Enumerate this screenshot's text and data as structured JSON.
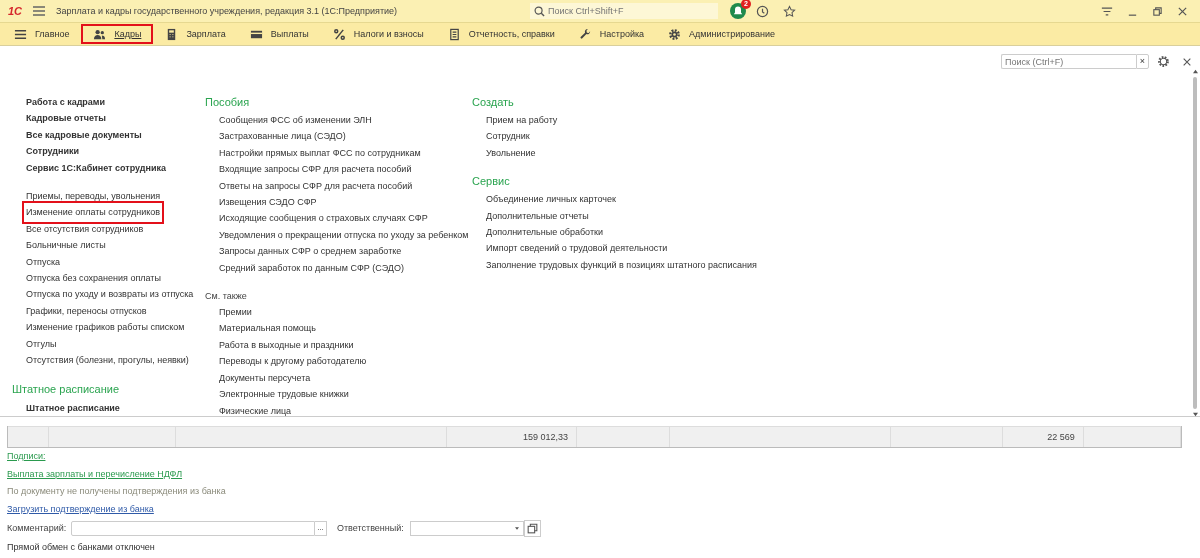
{
  "title_bar": {
    "logo": "1С",
    "title": "Зарплата и кадры государственного учреждения, редакция 3.1  (1С:Предприятие)",
    "search": {
      "placeholder": "Поиск Ctrl+Shift+F"
    },
    "notification_count": "2"
  },
  "sections": [
    {
      "label": "Главное",
      "selected": false,
      "highlighted": false
    },
    {
      "label": "Кадры",
      "selected": true,
      "highlighted": true
    },
    {
      "label": "Зарплата",
      "selected": false,
      "highlighted": false
    },
    {
      "label": "Выплаты",
      "selected": false,
      "highlighted": false
    },
    {
      "label": "Налоги и взносы",
      "selected": false,
      "highlighted": false
    },
    {
      "label": "Отчетность, справки",
      "selected": false,
      "highlighted": false
    },
    {
      "label": "Настройка",
      "selected": false,
      "highlighted": false
    },
    {
      "label": "Администрирование",
      "selected": false,
      "highlighted": false
    }
  ],
  "panel": {
    "search": {
      "placeholder": "Поиск (Ctrl+F)",
      "clear_button": "×"
    },
    "main_links": [
      "Работа с кадрами",
      "Кадровые отчеты",
      "Все кадровые документы",
      "Сотрудники",
      "Сервис 1С:Кабинет сотрудника"
    ],
    "links": [
      {
        "label": "Приемы, переводы, увольнения",
        "highlighted": false
      },
      {
        "label": "Изменение оплаты сотрудников",
        "highlighted": true
      },
      {
        "label": "Все отсутствия сотрудников",
        "highlighted": false
      },
      {
        "label": "Больничные листы",
        "highlighted": false
      },
      {
        "label": "Отпуска",
        "highlighted": false
      },
      {
        "label": "Отпуска без сохранения оплаты",
        "highlighted": false
      },
      {
        "label": "Отпуска по уходу и возвраты из отпуска",
        "highlighted": false
      },
      {
        "label": "Графики, переносы отпусков",
        "highlighted": false
      },
      {
        "label": "Изменение графиков работы списком",
        "highlighted": false
      },
      {
        "label": "Отгулы",
        "highlighted": false
      },
      {
        "label": "Отсутствия (болезни, прогулы, неявки)",
        "highlighted": false
      }
    ],
    "staff_group": {
      "title": "Штатное расписание",
      "main_links": [
        "Штатное расписание"
      ]
    },
    "middle_groups": [
      {
        "title": "Пособия",
        "kind": "section",
        "items": [
          "Сообщения ФСС об изменении ЭЛН",
          "Застрахованные лица (СЭДО)",
          "Настройки прямых выплат ФСС по сотрудникам",
          "Входящие запросы СФР для расчета пособий",
          "Ответы на запросы СФР для расчета пособий",
          "Извещения СЭДО СФР",
          "Исходящие сообщения о страховых случаях СФР",
          "Уведомления о прекращении отпуска по уходу за ребенком",
          "Запросы данных СФР о среднем заработке",
          "Средний заработок по данным СФР (СЭДО)"
        ]
      },
      {
        "title": "См. также",
        "kind": "see_also",
        "items": [
          "Премии",
          "Материальная помощь",
          "Работа в выходные и праздники",
          "Переводы к другому работодателю",
          "Документы персучета",
          "Электронные трудовые книжки",
          "Физические лица"
        ]
      }
    ],
    "right_groups": [
      {
        "title": "Создать",
        "kind": "section",
        "items": [
          "Прием на работу",
          "Сотрудник",
          "Увольнение"
        ]
      },
      {
        "title": "Сервис",
        "kind": "section",
        "items": [
          "Объединение личных карточек",
          "Дополнительные отчеты",
          "Дополнительные обработки",
          "Импорт сведений о трудовой деятельности",
          "Заполнение трудовых функций в позициях штатного расписания"
        ]
      }
    ]
  },
  "form": {
    "totals": [
      "159 012,33",
      "22 569"
    ],
    "signatures_link": "Подписи:",
    "payment_link": "Выплата зарплаты и перечисление НДФЛ",
    "bank_note": "По документу не получены подтверждения из банка",
    "load_link": "Загрузить подтверждение из банка",
    "comment": {
      "label": "Комментарий:",
      "choice_button": "..."
    },
    "responsible": {
      "label": "Ответственный:"
    },
    "exchange_note": "Прямой обмен с банками отключен"
  }
}
